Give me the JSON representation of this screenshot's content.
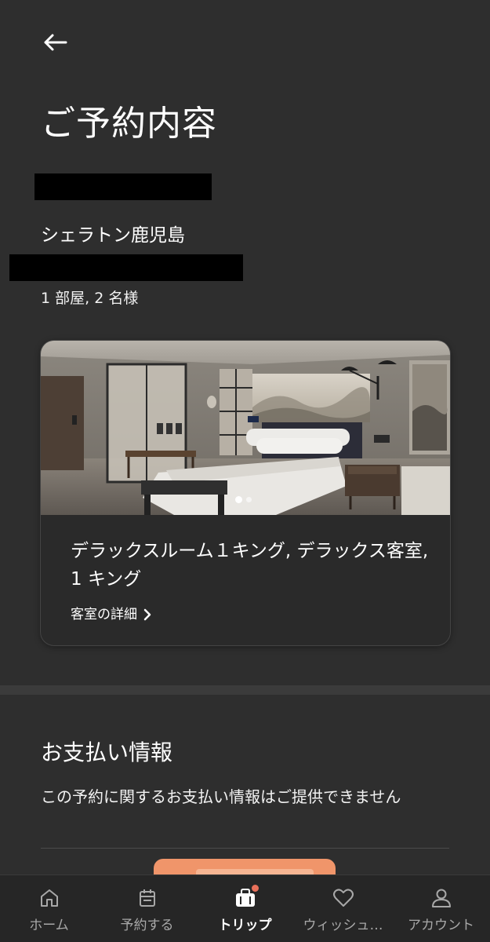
{
  "header": {
    "title": "ご予約内容"
  },
  "reservation": {
    "hotel_name": "シェラトン鹿児島",
    "room_guest_summary": "1 部屋, 2 名様"
  },
  "room_card": {
    "room_name": "デラックスルーム１キング, デラックス客室, 1 キング",
    "detail_link": "客室の詳細",
    "carousel_total": 2,
    "carousel_active": 1
  },
  "payment": {
    "title": "お支払い情報",
    "message": "この予約に関するお支払い情報はご提供できません"
  },
  "bottom_nav": {
    "items": [
      {
        "label": "ホーム",
        "icon": "home-icon"
      },
      {
        "label": "予約する",
        "icon": "calendar-icon"
      },
      {
        "label": "トリップ",
        "icon": "suitcase-icon"
      },
      {
        "label": "ウィッシュ…",
        "icon": "heart-icon"
      },
      {
        "label": "アカウント",
        "icon": "user-icon"
      }
    ],
    "active": "トリップ"
  },
  "colors": {
    "background": "#2e2e2e",
    "card": "#2a2a2a",
    "accent": "#f0956a",
    "badge": "#e8705a"
  }
}
